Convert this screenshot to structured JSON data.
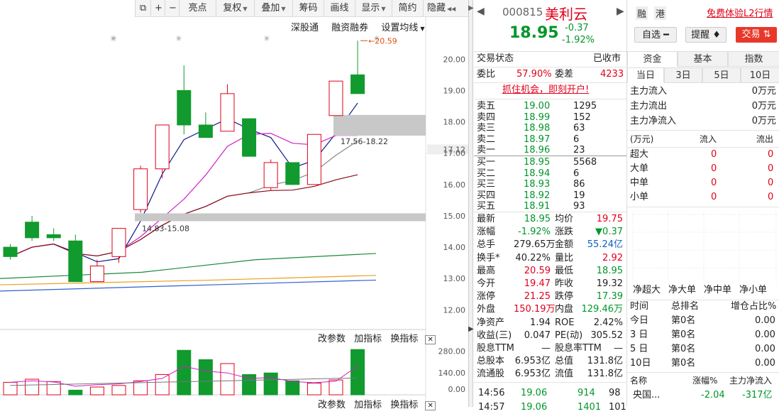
{
  "toolbar": {
    "items": [
      "亮点",
      "复权",
      "叠加",
      "筹码",
      "画线",
      "显示",
      "简约",
      "隐藏"
    ],
    "plus": "+",
    "minus": "−"
  },
  "chart": {
    "indicator_links": [
      "深股通",
      "融资融券",
      "设置均线"
    ],
    "sub_links": [
      "改参数",
      "加指标",
      "换指标"
    ],
    "close_glyph": "✕",
    "price_ticks": [
      "20.00",
      "19.00",
      "18.00",
      "17.12",
      "17.00",
      "16.00",
      "15.00",
      "14.00",
      "13.00",
      "12.00"
    ],
    "vol_ticks": [
      "280.00",
      "140.00",
      "0.00"
    ],
    "high_label": "20.59",
    "zone_upper_label": "17.56-18.22",
    "zone_lower_label": "14.83-15.08",
    "star_glyph": "✳"
  },
  "chart_data": {
    "type": "candlestick",
    "ylim": [
      11.6,
      20.8
    ],
    "up_color": "#e0001a",
    "down_color": "#119a2e",
    "candles": [
      {
        "o": 14.0,
        "c": 13.7,
        "h": 14.1,
        "l": 13.6
      },
      {
        "o": 14.8,
        "c": 14.3,
        "h": 15.0,
        "l": 14.2
      },
      {
        "o": 14.4,
        "c": 14.3,
        "h": 14.6,
        "l": 14.2
      },
      {
        "o": 14.2,
        "c": 12.9,
        "h": 14.4,
        "l": 12.9
      },
      {
        "o": 12.9,
        "c": 13.4,
        "h": 13.6,
        "l": 12.9
      },
      {
        "o": 13.7,
        "c": 14.6,
        "h": 14.6,
        "l": 13.5
      },
      {
        "o": 15.2,
        "c": 16.5,
        "h": 16.6,
        "l": 15.1
      },
      {
        "o": 16.5,
        "c": 17.9,
        "h": 17.9,
        "l": 16.2
      },
      {
        "o": 19.0,
        "c": 17.9,
        "h": 19.8,
        "l": 17.6
      },
      {
        "o": 17.9,
        "c": 17.5,
        "h": 18.3,
        "l": 17.5
      },
      {
        "o": 17.7,
        "c": 18.9,
        "h": 19.2,
        "l": 17.7
      },
      {
        "o": 18.1,
        "c": 16.9,
        "h": 18.1,
        "l": 16.9
      },
      {
        "o": 15.9,
        "c": 16.7,
        "h": 16.8,
        "l": 15.8
      },
      {
        "o": 16.7,
        "c": 16.0,
        "h": 16.7,
        "l": 16.0
      },
      {
        "o": 16.0,
        "c": 17.6,
        "h": 17.6,
        "l": 16.0
      },
      {
        "o": 18.2,
        "c": 19.3,
        "h": 19.3,
        "l": 18.2
      },
      {
        "o": 19.5,
        "c": 18.9,
        "h": 20.59,
        "l": 18.9
      }
    ],
    "volume": [
      {
        "v": 80,
        "up": true
      },
      {
        "v": 100,
        "up": true
      },
      {
        "v": 85,
        "up": true
      },
      {
        "v": 30,
        "up": false
      },
      {
        "v": 50,
        "up": true
      },
      {
        "v": 60,
        "up": true
      },
      {
        "v": 90,
        "up": true
      },
      {
        "v": 130,
        "up": true
      },
      {
        "v": 285,
        "up": false
      },
      {
        "v": 225,
        "up": false
      },
      {
        "v": 200,
        "up": true
      },
      {
        "v": 130,
        "up": false
      },
      {
        "v": 140,
        "up": false
      },
      {
        "v": 90,
        "up": false
      },
      {
        "v": 75,
        "up": true
      },
      {
        "v": 95,
        "up": true
      },
      {
        "v": 290,
        "up": false
      }
    ],
    "vol_ylim": [
      0,
      300
    ]
  },
  "quote": {
    "code": "000815",
    "name": "美利云",
    "tag1": "融",
    "tag2": "港",
    "trial_link": "免费体验L2行情",
    "price": "18.95",
    "change": "-0.37",
    "change_pct": "-1.92%",
    "watch_btn": "自选",
    "alert_btn": "提醒",
    "trade_btn": "交易",
    "status_label": "交易状态",
    "status_value": "已收市",
    "weibi_label": "委比",
    "weibi_value": "57.90%",
    "weicha_label": "委差",
    "weicha_value": "4233",
    "promo": "抓住机会，即刻开户!",
    "asks": [
      {
        "label": "卖五",
        "price": "19.00",
        "vol": "1295"
      },
      {
        "label": "卖四",
        "price": "18.99",
        "vol": "152"
      },
      {
        "label": "卖三",
        "price": "18.98",
        "vol": "63"
      },
      {
        "label": "卖二",
        "price": "18.97",
        "vol": "6"
      },
      {
        "label": "卖一",
        "price": "18.96",
        "vol": "23"
      }
    ],
    "bids": [
      {
        "label": "买一",
        "price": "18.95",
        "vol": "5568"
      },
      {
        "label": "买二",
        "price": "18.94",
        "vol": "6"
      },
      {
        "label": "买三",
        "price": "18.93",
        "vol": "86"
      },
      {
        "label": "买四",
        "price": "18.92",
        "vol": "19"
      },
      {
        "label": "买五",
        "price": "18.91",
        "vol": "93"
      }
    ],
    "stats": [
      {
        "l1": "最新",
        "v1": "18.95",
        "c1": "green",
        "l2": "均价",
        "v2": "19.75",
        "c2": "red"
      },
      {
        "l1": "涨幅",
        "v1": "-1.92%",
        "c1": "green",
        "l2": "涨跌",
        "v2": "▼0.37",
        "c2": "green"
      },
      {
        "l1": "总手",
        "v1": "279.65万",
        "c1": "black",
        "l2": "金额",
        "v2": "55.24亿",
        "c2": "blue"
      },
      {
        "l1": "换手*",
        "v1": "40.22%",
        "c1": "black",
        "l2": "量比",
        "v2": "2.92",
        "c2": "red"
      },
      {
        "l1": "最高",
        "v1": "20.59",
        "c1": "red",
        "l2": "最低",
        "v2": "18.95",
        "c2": "green"
      },
      {
        "l1": "今开",
        "v1": "19.47",
        "c1": "red",
        "l2": "昨收",
        "v2": "19.32",
        "c2": "black"
      },
      {
        "l1": "涨停",
        "v1": "21.25",
        "c1": "red",
        "l2": "跌停",
        "v2": "17.39",
        "c2": "green"
      },
      {
        "l1": "外盘",
        "v1": "150.19万",
        "c1": "red",
        "l2": "内盘",
        "v2": "129.46万",
        "c2": "green"
      },
      {
        "l1": "净资产",
        "v1": "1.94",
        "c1": "black",
        "l2": "ROE",
        "v2": "2.42%",
        "c2": "black"
      },
      {
        "l1": "收益(三)",
        "v1": "0.047",
        "c1": "black",
        "l2": "PE(动)",
        "v2": "305.52",
        "c2": "black"
      },
      {
        "l1": "股息TTM",
        "v1": "—",
        "c1": "black",
        "l2": "股息率TTM",
        "v2": "—",
        "c2": "black"
      },
      {
        "l1": "总股本",
        "v1": "6.953亿",
        "c1": "black",
        "l2": "总值",
        "v2": "131.8亿",
        "c2": "black"
      },
      {
        "l1": "流通股",
        "v1": "6.953亿",
        "c1": "black",
        "l2": "流值",
        "v2": "131.8亿",
        "c2": "black"
      }
    ],
    "ticks": [
      {
        "time": "14:56",
        "price": "19.06",
        "vol": "914",
        "num": "98"
      },
      {
        "time": "14:57",
        "price": "19.06",
        "vol": "1401",
        "num": "101"
      }
    ]
  },
  "fund": {
    "tabs": [
      "资金",
      "基本",
      "指数"
    ],
    "period_tabs": [
      "当日",
      "3日",
      "5日",
      "10日"
    ],
    "flows": [
      {
        "label": "主力流入",
        "value": "0万元"
      },
      {
        "label": "主力流出",
        "value": "0万元"
      },
      {
        "label": "主力净流入",
        "value": "0万元"
      }
    ],
    "unit": "(万元)",
    "in_label": "流入",
    "out_label": "流出",
    "sizes": [
      {
        "label": "超大",
        "in": "0",
        "out": "0"
      },
      {
        "label": "大单",
        "in": "0",
        "out": "0"
      },
      {
        "label": "中单",
        "in": "0",
        "out": "0"
      },
      {
        "label": "小单",
        "in": "0",
        "out": "0"
      }
    ],
    "net_labels": [
      "净超大",
      "净大单",
      "净中单",
      "净小单"
    ],
    "rank_headers": [
      "时间",
      "总排名",
      "增仓占比%"
    ],
    "ranks": [
      {
        "t": "今日",
        "r": "第0名",
        "p": "0.00"
      },
      {
        "t": "3 日",
        "r": "第0名",
        "p": "0.00"
      },
      {
        "t": "5 日",
        "r": "第0名",
        "p": "0.00"
      },
      {
        "t": "10日",
        "r": "第0名",
        "p": "0.00"
      }
    ],
    "sector_headers": [
      "名称",
      "涨幅%",
      "主力净流入"
    ],
    "sector": {
      "name": "央国...",
      "pct": "-2.04",
      "flow": "-317亿"
    }
  }
}
